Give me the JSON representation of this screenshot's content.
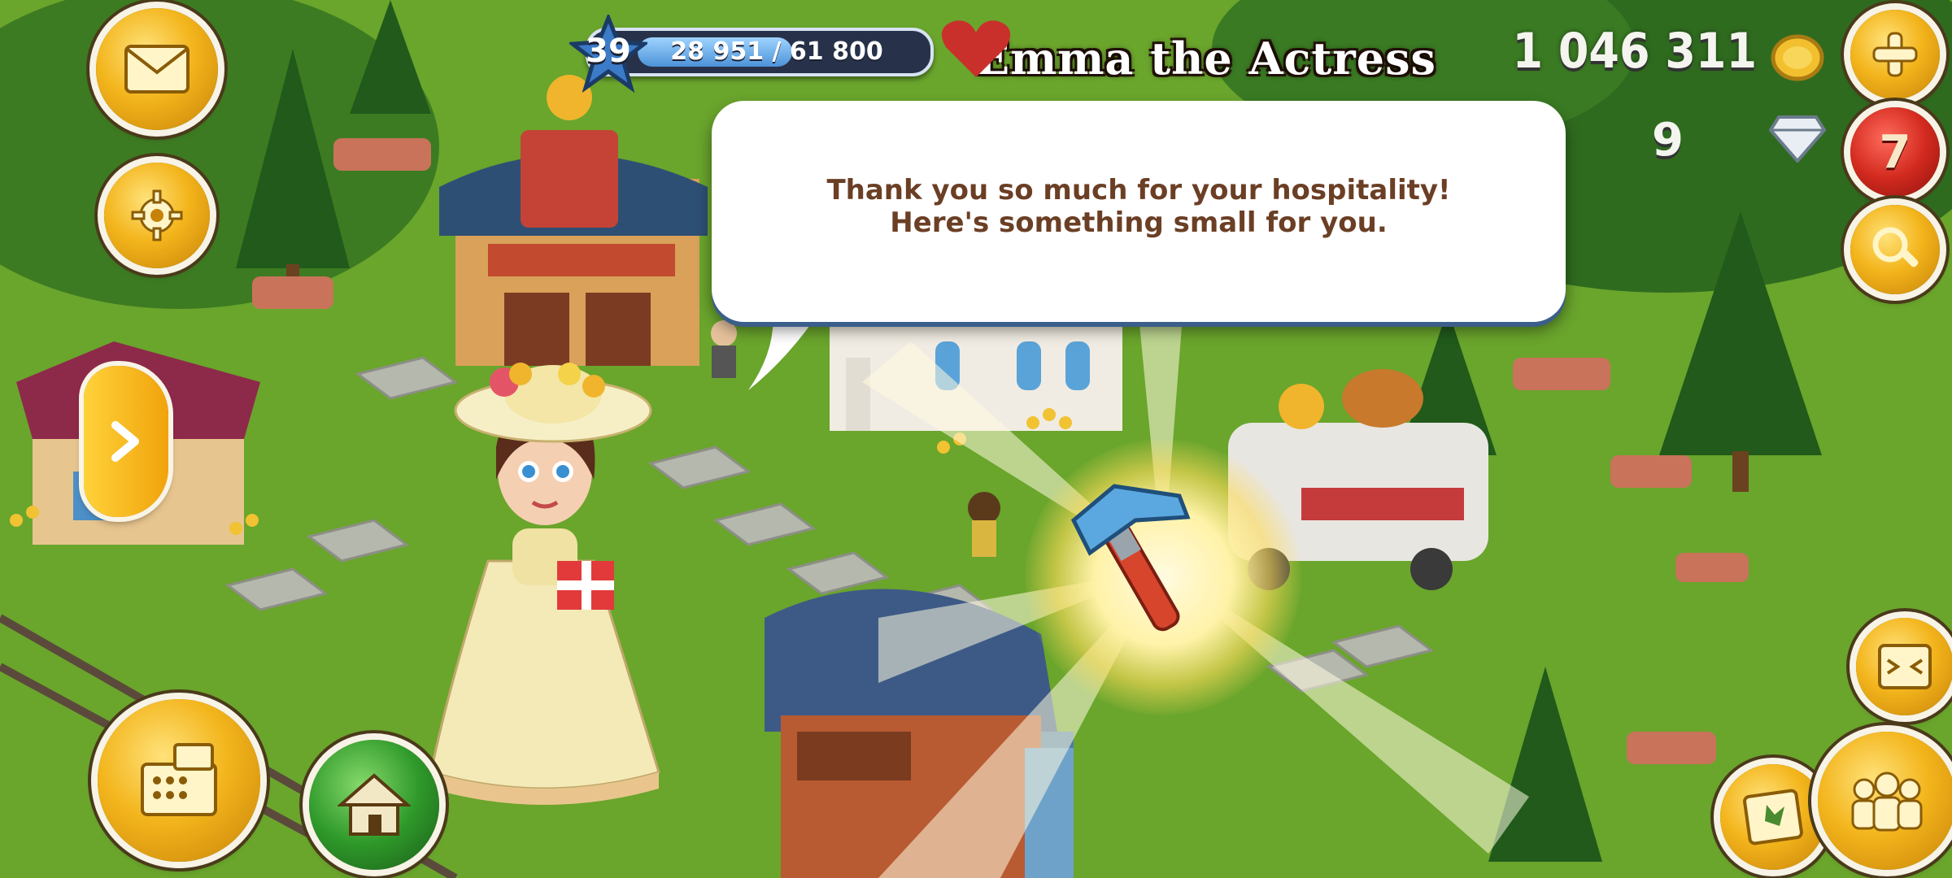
{
  "hud": {
    "level": "39",
    "xp_text": "28 951 / 61 800",
    "coins": "1 046 311",
    "gems": "9",
    "notification_count": "7"
  },
  "dialog": {
    "npc_name": "Emma the Actress",
    "message": "Thank you so much for your hospitality! Here's something small for you."
  },
  "reward": {
    "icon": "hammer-icon"
  },
  "icons": {
    "mail": "mail-icon",
    "settings": "gear-icon",
    "add": "plus-icon",
    "search": "magnifier-icon",
    "shop": "cash-register-icon",
    "home": "house-icon",
    "friends": "friends-icon",
    "map": "map-icon",
    "expand": "expand-icon",
    "side": "chevron-right-icon"
  },
  "colors": {
    "hud_gold": "#f3b51c",
    "hud_red": "#d32a1f",
    "text_brown": "#6b3f25",
    "xp_blue": "#4c93d8"
  }
}
